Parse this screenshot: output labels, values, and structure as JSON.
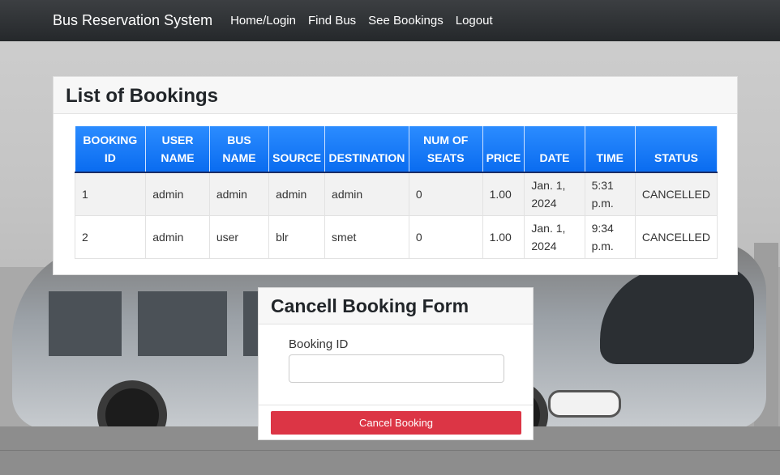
{
  "navbar": {
    "brand": "Bus Reservation System",
    "links": [
      "Home/Login",
      "Find Bus",
      "See Bookings",
      "Logout"
    ]
  },
  "bookings": {
    "title": "List of Bookings",
    "headers": [
      [
        "BOOKING",
        "ID"
      ],
      [
        "USER",
        "NAME"
      ],
      [
        "BUS",
        "NAME"
      ],
      [
        "",
        "SOURCE"
      ],
      [
        "",
        "DESTINATION"
      ],
      [
        "NUM OF",
        "SEATS"
      ],
      [
        "",
        "PRICE"
      ],
      [
        "",
        "DATE"
      ],
      [
        "",
        "TIME"
      ],
      [
        "",
        "STATUS"
      ]
    ],
    "rows": [
      {
        "booking_id": "1",
        "user_name": "admin",
        "bus_name": "admin",
        "source": "admin",
        "destination": "admin",
        "num_seats": "0",
        "price": "1.00",
        "date_1": "Jan. 1,",
        "date_2": "2024",
        "time_1": "5:31",
        "time_2": "p.m.",
        "status": "CANCELLED"
      },
      {
        "booking_id": "2",
        "user_name": "admin",
        "bus_name": "user",
        "source": "blr",
        "destination": "smet",
        "num_seats": "0",
        "price": "1.00",
        "date_1": "Jan. 1,",
        "date_2": "2024",
        "time_1": "9:34",
        "time_2": "p.m.",
        "status": "CANCELLED"
      }
    ]
  },
  "cancel_form": {
    "title": "Cancell Booking Form",
    "field_label": "Booking ID",
    "field_value": "",
    "button_label": "Cancel Booking"
  },
  "colors": {
    "navbar": "#2b2e31",
    "table_header": "#0d6efd",
    "danger": "#dc3545"
  }
}
